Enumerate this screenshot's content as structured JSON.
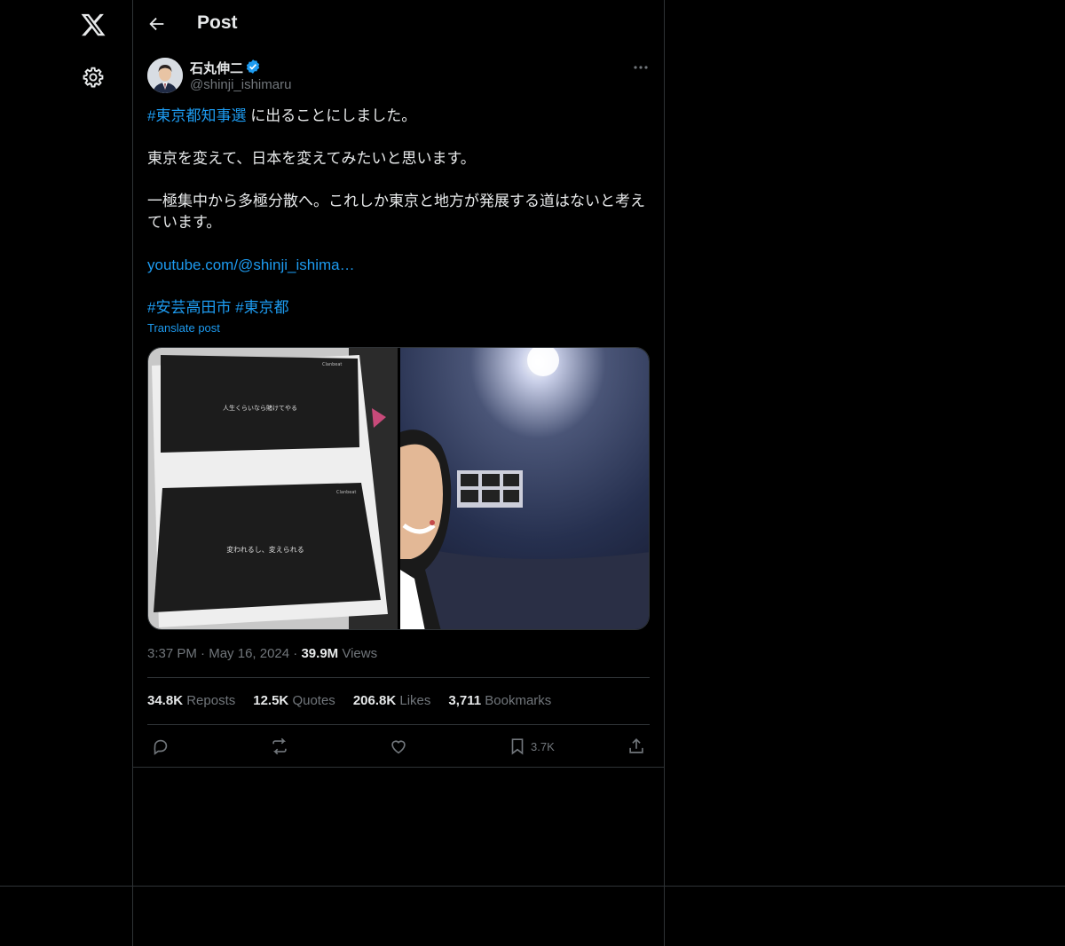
{
  "header": {
    "title": "Post",
    "back_icon": "arrow-left-icon"
  },
  "nav": {
    "logo_icon": "x-logo-icon",
    "settings_icon": "gear-icon"
  },
  "author": {
    "name": "石丸伸二",
    "handle": "@shinji_ishimaru",
    "verified": true
  },
  "post": {
    "hashtag_election": "#東京都知事選",
    "line1_rest": " に出ることにしました。",
    "line2": "東京を変えて、日本を変えてみたいと思います。",
    "line3": "一極集中から多極分散へ。これしか東京と地方が発展する道はないと考えています。",
    "link": "youtube.com/@shinji_ishima…",
    "hashtag_city": "#安芸高田市",
    "hashtag_tokyo": "#東京都",
    "translate": "Translate post"
  },
  "media": {
    "left_image_text_top": "人生くらいなら賭けてやる",
    "left_image_text_bottom": "変われるし、変えられる",
    "left_image_brand": "Clanbeat"
  },
  "meta": {
    "time": "3:37 PM",
    "date": "May 16, 2024",
    "views_count": "39.9M",
    "views_label": "Views",
    "sep": "·"
  },
  "stats": {
    "reposts_count": "34.8K",
    "reposts_label": "Reposts",
    "quotes_count": "12.5K",
    "quotes_label": "Quotes",
    "likes_count": "206.8K",
    "likes_label": "Likes",
    "bookmarks_count": "3,711",
    "bookmarks_label": "Bookmarks"
  },
  "actions": {
    "bookmark_count": "3.7K"
  },
  "colors": {
    "accent": "#1d9bf0",
    "background": "#000000",
    "border": "#2f3336",
    "muted": "#71767b",
    "text": "#e7e9ea"
  }
}
